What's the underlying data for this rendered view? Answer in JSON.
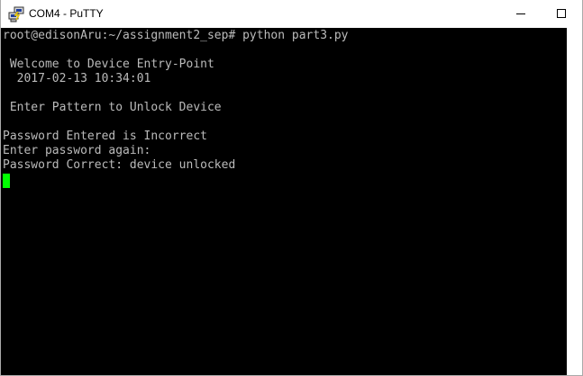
{
  "window": {
    "title": "COM4 - PuTTY",
    "icon": "putty-computers-icon"
  },
  "terminal": {
    "lines": [
      "root@edisonAru:~/assignment2_sep# python part3.py",
      "",
      " Welcome to Device Entry-Point",
      "  2017-02-13 10:34:01",
      "",
      " Enter Pattern to Unlock Device",
      "",
      "Password Entered is Incorrect",
      "Enter password again:",
      "Password Correct: device unlocked"
    ],
    "background_color": "#000000",
    "text_color": "#bbbbbb",
    "cursor_color": "#00ff00"
  }
}
